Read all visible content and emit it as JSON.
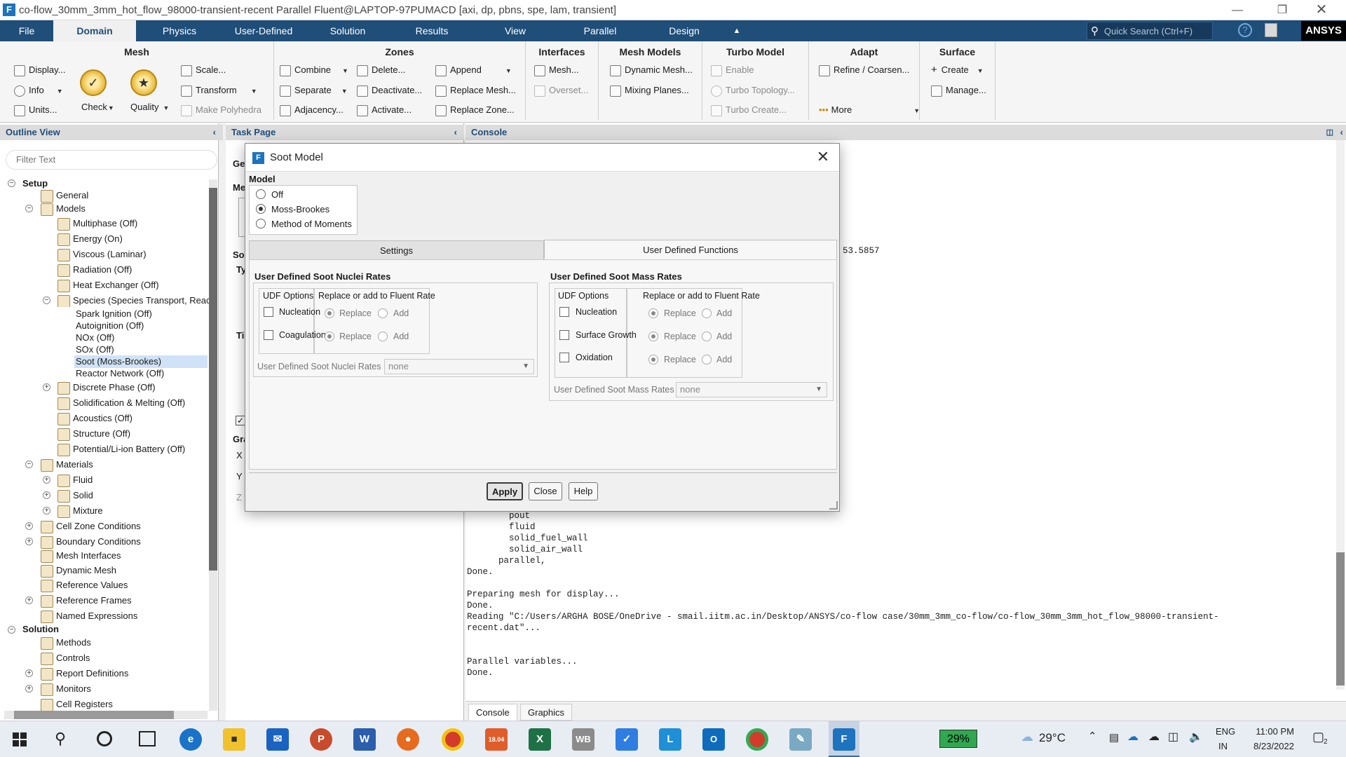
{
  "window": {
    "title": "co-flow_30mm_3mm_hot_flow_98000-transient-recent Parallel Fluent@LAPTOP-97PUMACD  [axi, dp, pbns, spe, lam, transient]"
  },
  "menu": {
    "tabs": [
      "File",
      "Domain",
      "Physics",
      "User-Defined",
      "Solution",
      "Results",
      "View",
      "Parallel",
      "Design"
    ],
    "active": "Domain",
    "quick_search_placeholder": "Quick Search (Ctrl+F)",
    "logo": "ANSYS"
  },
  "ribbon": {
    "mesh": {
      "title": "Mesh",
      "display": "Display...",
      "info": "Info",
      "units": "Units...",
      "check": "Check",
      "quality": "Quality",
      "scale": "Scale...",
      "transform": "Transform",
      "make_polyhedra": "Make Polyhedra"
    },
    "zones": {
      "title": "Zones",
      "combine": "Combine",
      "separate": "Separate",
      "adjacency": "Adjacency...",
      "delete": "Delete...",
      "deactivate": "Deactivate...",
      "activate": "Activate...",
      "append": "Append",
      "replace_mesh": "Replace Mesh...",
      "replace_zone": "Replace Zone..."
    },
    "interfaces": {
      "title": "Interfaces",
      "mesh": "Mesh...",
      "overset": "Overset..."
    },
    "mesh_models": {
      "title": "Mesh Models",
      "dynamic_mesh": "Dynamic Mesh...",
      "mixing_planes": "Mixing Planes..."
    },
    "turbo_model": {
      "title": "Turbo Model",
      "enable": "Enable",
      "turbo_topology": "Turbo Topology...",
      "turbo_create": "Turbo Create..."
    },
    "adapt": {
      "title": "Adapt",
      "refine": "Refine / Coarsen...",
      "more": "More"
    },
    "surface": {
      "title": "Surface",
      "create": "Create",
      "manage": "Manage..."
    }
  },
  "outline": {
    "header": "Outline View",
    "filter_placeholder": "Filter Text",
    "items": [
      {
        "label": "Setup"
      },
      {
        "label": "General"
      },
      {
        "label": "Models"
      },
      {
        "label": "Multiphase (Off)"
      },
      {
        "label": "Energy (On)"
      },
      {
        "label": "Viscous (Laminar)"
      },
      {
        "label": "Radiation (Off)"
      },
      {
        "label": "Heat Exchanger (Off)"
      },
      {
        "label": "Species (Species Transport, Reac"
      },
      {
        "label": "Spark Ignition (Off)"
      },
      {
        "label": "Autoignition (Off)"
      },
      {
        "label": "NOx (Off)"
      },
      {
        "label": "SOx (Off)"
      },
      {
        "label": "Soot (Moss-Brookes)"
      },
      {
        "label": "Reactor Network (Off)"
      },
      {
        "label": "Discrete Phase (Off)"
      },
      {
        "label": "Solidification & Melting (Off)"
      },
      {
        "label": "Acoustics (Off)"
      },
      {
        "label": "Structure (Off)"
      },
      {
        "label": "Potential/Li-ion Battery (Off)"
      },
      {
        "label": "Materials"
      },
      {
        "label": "Fluid"
      },
      {
        "label": "Solid"
      },
      {
        "label": "Mixture"
      },
      {
        "label": "Cell Zone Conditions"
      },
      {
        "label": "Boundary Conditions"
      },
      {
        "label": "Mesh Interfaces"
      },
      {
        "label": "Dynamic Mesh"
      },
      {
        "label": "Reference Values"
      },
      {
        "label": "Reference Frames"
      },
      {
        "label": "Named Expressions"
      },
      {
        "label": "Solution"
      },
      {
        "label": "Methods"
      },
      {
        "label": "Controls"
      },
      {
        "label": "Report Definitions"
      },
      {
        "label": "Monitors"
      },
      {
        "label": "Cell Registers"
      }
    ]
  },
  "task_page": {
    "header": "Task Page",
    "fragments": [
      "Ge",
      "Me",
      "Sol",
      "Ty",
      "Ti",
      "Gra",
      "X",
      "Y",
      "Z"
    ]
  },
  "console": {
    "header": "Console",
    "partial_value": "53.5857",
    "lines": [
      "        pout",
      "        fluid",
      "        solid_fuel_wall",
      "        solid_air_wall",
      "      parallel,",
      "Done.",
      "",
      "Preparing mesh for display...",
      "Done.",
      "Reading \"C:/Users/ARGHA BOSE/OneDrive - smail.iitm.ac.in/Desktop/ANSYS/co-flow case/30mm_3mm_co-flow/co-flow_30mm_3mm_hot_flow_98000-transient-",
      "recent.dat\"...",
      "",
      "",
      "Parallel variables...",
      "Done."
    ],
    "tabs": [
      "Console",
      "Graphics"
    ]
  },
  "dialog": {
    "title": "Soot Model",
    "model_label": "Model",
    "model_options": [
      "Off",
      "Moss-Brookes",
      "Method of Moments"
    ],
    "model_selected": "Moss-Brookes",
    "tabs": [
      "Settings",
      "User Defined Functions"
    ],
    "active_tab": "User Defined Functions",
    "nuclei": {
      "title": "User Defined Soot Nuclei Rates",
      "udf_options": "UDF Options",
      "replace_or_add": "Replace or add to Fluent Rate",
      "rows": [
        {
          "label": "Nucleation",
          "replace": "Replace",
          "add": "Add"
        },
        {
          "label": "Coagulation",
          "replace": "Replace",
          "add": "Add"
        }
      ],
      "select_label": "User Defined Soot Nuclei Rates",
      "select_value": "none"
    },
    "mass": {
      "title": "User Defined Soot Mass Rates",
      "udf_options": "UDF Options",
      "replace_or_add": "Replace or add to Fluent Rate",
      "rows": [
        {
          "label": "Nucleation",
          "replace": "Replace",
          "add": "Add"
        },
        {
          "label": "Surface Growth",
          "replace": "Replace",
          "add": "Add"
        },
        {
          "label": "Oxidation",
          "replace": "Replace",
          "add": "Add"
        }
      ],
      "select_label": "User Defined Soot Mass Rates",
      "select_value": "none"
    },
    "buttons": {
      "apply": "Apply",
      "close": "Close",
      "help": "Help"
    }
  },
  "taskbar": {
    "battery": "29%",
    "temperature": "29°C",
    "lang": "ENG",
    "region": "IN",
    "time": "11:00 PM",
    "date": "8/23/2022",
    "notifications": "2",
    "apps": [
      "Edge",
      "File Explorer",
      "Mail",
      "PowerPoint",
      "Word",
      "Firefox",
      "Chrome",
      "18.04",
      "Excel",
      "WB",
      "To Do",
      "L",
      "Outlook",
      "Chrome",
      "Notepad",
      "Fluent"
    ]
  }
}
